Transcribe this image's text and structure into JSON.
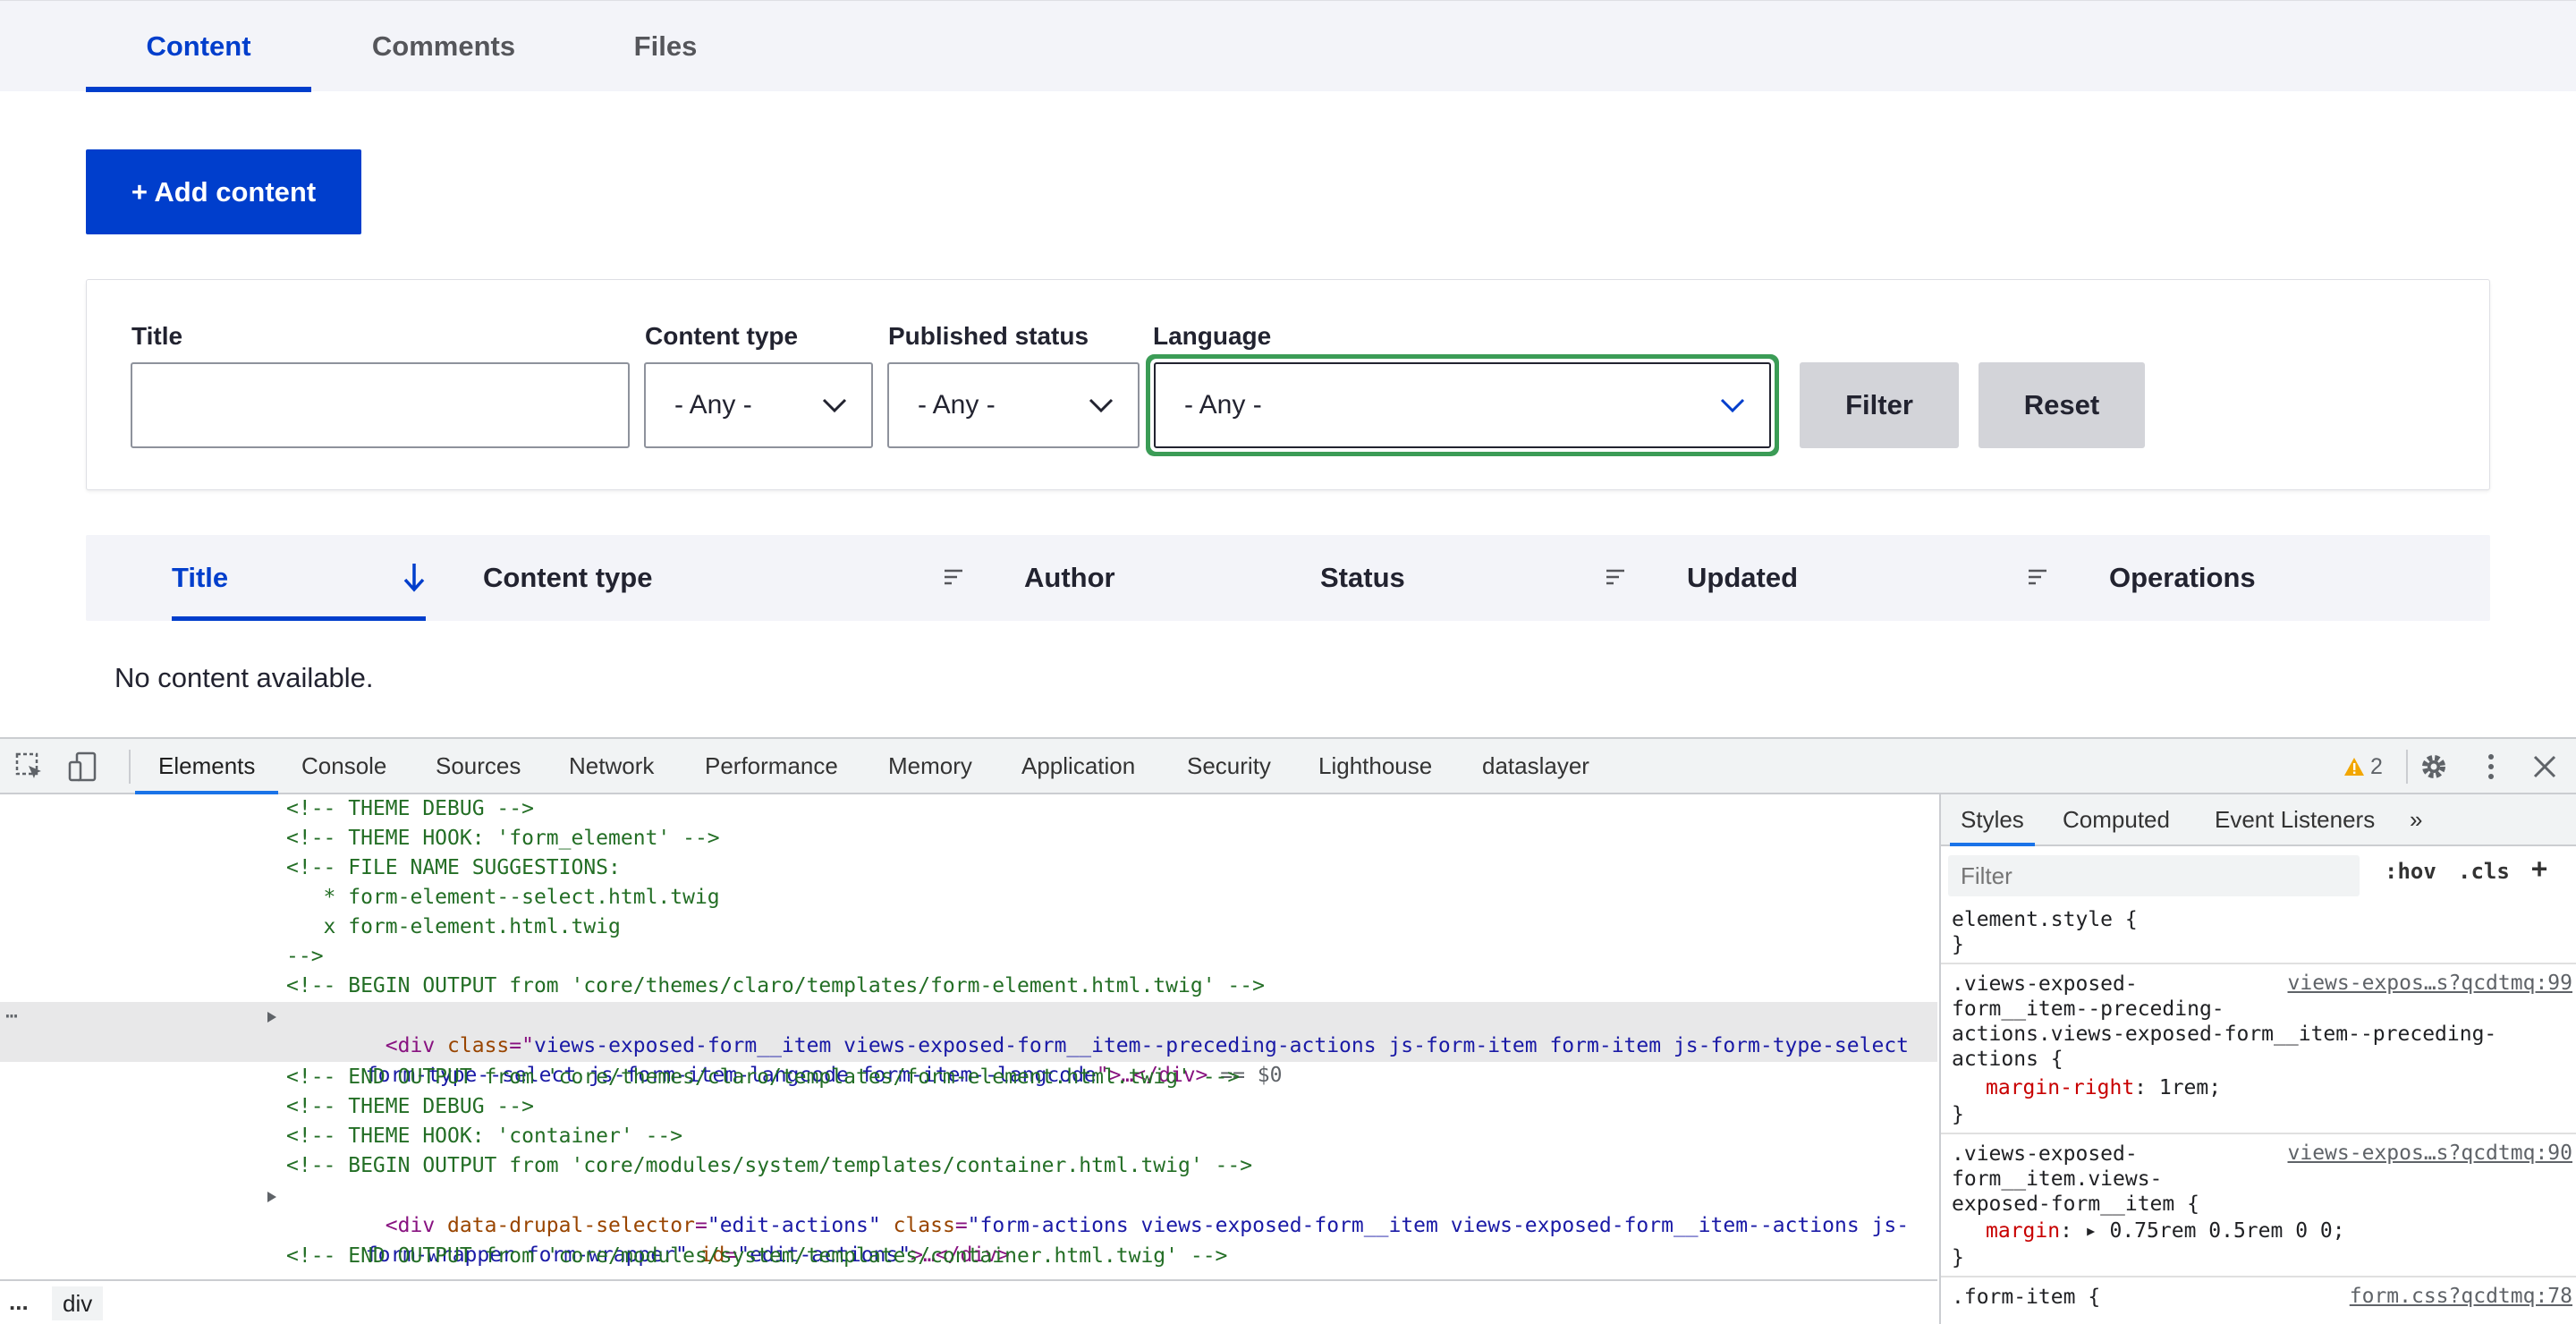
{
  "tabs": [
    {
      "label": "Content",
      "active": true
    },
    {
      "label": "Comments",
      "active": false
    },
    {
      "label": "Files",
      "active": false
    }
  ],
  "add_button": "+ Add content",
  "filters": {
    "title_label": "Title",
    "title_value": "",
    "content_type_label": "Content type",
    "content_type_value": "- Any -",
    "published_label": "Published status",
    "published_value": "- Any -",
    "language_label": "Language",
    "language_value": "- Any -",
    "filter_button": "Filter",
    "reset_button": "Reset"
  },
  "table": {
    "columns": [
      "Title",
      "Content type",
      "Author",
      "Status",
      "Updated",
      "Operations"
    ],
    "empty_message": "No content available."
  },
  "devtools": {
    "tabs": [
      "Elements",
      "Console",
      "Sources",
      "Network",
      "Performance",
      "Memory",
      "Application",
      "Security",
      "Lighthouse",
      "dataslayer"
    ],
    "warning_count": "2",
    "dom_lines": {
      "l1": "<!-- THEME DEBUG -->",
      "l2": "<!-- THEME HOOK: 'form_element' -->",
      "l3": "<!-- FILE NAME SUGGESTIONS:",
      "l4": "   * form-element--select.html.twig",
      "l5": "   x form-element.html.twig",
      "l6": "-->",
      "l7": "<!-- BEGIN OUTPUT from 'core/themes/claro/templates/form-element.html.twig' -->",
      "l8_tag": "<div ",
      "l8_attr": "class",
      "l8_eq": "=\"",
      "l8_val": "views-exposed-form__item views-exposed-form__item--preceding-actions js-form-item form-item js-form-type-select",
      "l9_val": "form-type--select js-form-item-langcode form-item--langcode",
      "l9_close": "\">…</div>",
      "l9_marker": " == $0",
      "l10": "<!-- END OUTPUT from 'core/themes/claro/templates/form-element.html.twig' -->",
      "l11": "<!-- THEME DEBUG -->",
      "l12": "<!-- THEME HOOK: 'container' -->",
      "l13": "<!-- BEGIN OUTPUT from 'core/modules/system/templates/container.html.twig' -->",
      "l14_tag": "<div ",
      "l14_attr1": "data-drupal-selector",
      "l14_val1": "\"edit-actions\"",
      "l14_attr2": " class",
      "l14_val2": "\"form-actions views-exposed-form__item views-exposed-form__item--actions js-",
      "l15_val": "form-wrapper form-wrapper\"",
      "l15_attr": " id",
      "l15_val2": "\"edit-actions\"",
      "l15_close": ">…</div>",
      "l16": "<!-- END OUTPUT from 'core/modules/system/templates/container.html.twig' -->"
    },
    "breadcrumb": "div",
    "breadcrumb_dots": "...",
    "styles": {
      "tabs": [
        "Styles",
        "Computed",
        "Event Listeners",
        "»"
      ],
      "filter_placeholder": "Filter",
      "hov": ":hov",
      "cls": ".cls",
      "plus": "+",
      "r1_l1": "element.style {",
      "r1_l2": "}",
      "r2_l1": ".views-exposed-",
      "r2_l2": "form__item--preceding-",
      "r2_l3": "actions.views-exposed-form__item--preceding-",
      "r2_l4": "actions {",
      "r2_prop": "margin-right",
      "r2_val": ": 1rem;",
      "r2_l6": "}",
      "r2_src": "views-expos…s?qcdtmq:99",
      "r3_l1": ".views-exposed-",
      "r3_l2": "form__item.views-",
      "r3_l3": "exposed-form__item {",
      "r3_prop": "margin",
      "r3_val": ": ▸ 0.75rem 0.5rem 0 0;",
      "r3_l5": "}",
      "r3_src": "views-expos…s?qcdtmq:90",
      "r4_l1": ".form-item {",
      "r4_src": "form.css?qcdtmq:78"
    }
  }
}
